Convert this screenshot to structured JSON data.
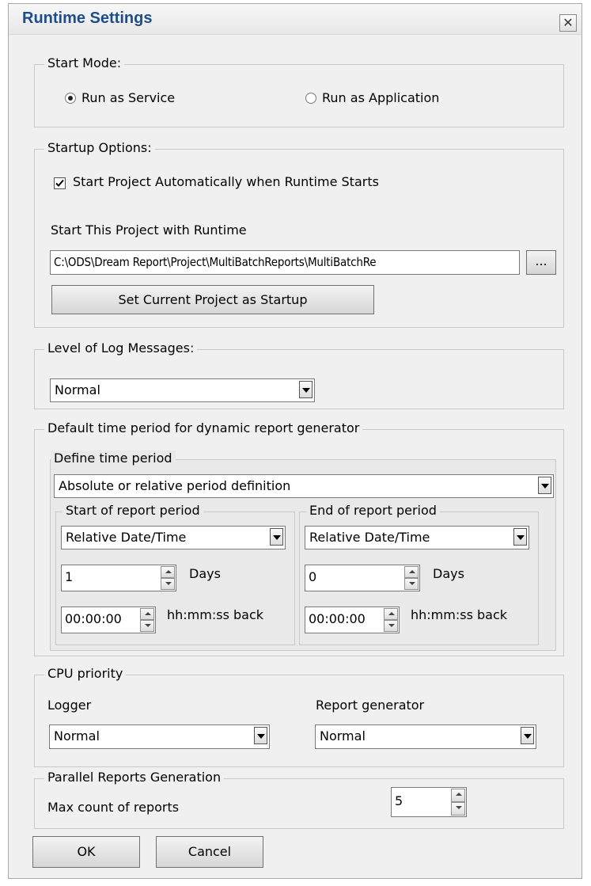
{
  "window": {
    "title": "Runtime Settings",
    "close_label": "✕"
  },
  "start_mode": {
    "legend": "Start Mode:",
    "options": [
      {
        "label": "Run as Service",
        "selected": true
      },
      {
        "label": "Run as Application",
        "selected": false
      }
    ]
  },
  "startup": {
    "legend": "Startup Options:",
    "auto_start_label": "Start Project Automatically when Runtime Starts",
    "auto_start_checked": true,
    "project_label": "Start This Project with Runtime",
    "project_path": "C:\\ODS\\Dream Report\\Project\\MultiBatchReports\\MultiBatchRe",
    "browse_label": "...",
    "set_current_label": "Set Current Project as Startup"
  },
  "log": {
    "legend": "Level of Log Messages:",
    "value": "Normal"
  },
  "period": {
    "legend": "Default time period for dynamic report generator",
    "define": {
      "legend": "Define time period",
      "value": "Absolute or relative period definition"
    },
    "start": {
      "legend": "Start of report period",
      "mode": "Relative Date/Time",
      "days": "1",
      "days_label": "Days",
      "time": "00:00:00",
      "time_label": "hh:mm:ss back"
    },
    "end": {
      "legend": "End of report period",
      "mode": "Relative Date/Time",
      "days": "0",
      "days_label": "Days",
      "time": "00:00:00",
      "time_label": "hh:mm:ss back"
    }
  },
  "cpu": {
    "legend": "CPU priority",
    "logger_label": "Logger",
    "logger_value": "Normal",
    "generator_label": "Report generator",
    "generator_value": "Normal"
  },
  "parallel": {
    "legend": "Parallel Reports Generation",
    "max_label": "Max count of reports",
    "max_value": "5"
  },
  "buttons": {
    "ok": "OK",
    "cancel": "Cancel"
  }
}
